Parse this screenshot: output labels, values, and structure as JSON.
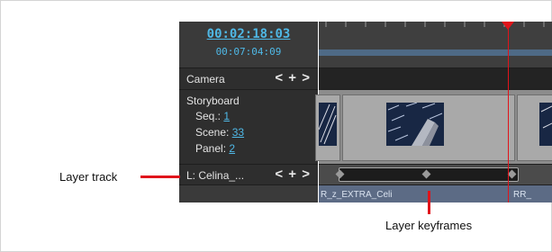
{
  "timecode": {
    "main": "00:02:18:03",
    "sub": "00:07:04:09"
  },
  "camera": {
    "label": "Camera",
    "nav": {
      "prev": "<",
      "add": "+",
      "next": ">"
    }
  },
  "storyboard": {
    "title": "Storyboard",
    "seq_label": "Seq.:",
    "seq_value": "1",
    "scene_label": "Scene:",
    "scene_value": "33",
    "panel_label": "Panel:",
    "panel_value": "2"
  },
  "layer": {
    "label": "L: Celina_...",
    "nav": {
      "prev": "<",
      "add": "+",
      "next": ">"
    }
  },
  "clips": [
    "R_z_EXTRA_Celi",
    "RR_"
  ],
  "callouts": {
    "layer_track": "Layer track",
    "layer_keyframes": "Layer keyframes"
  },
  "colors": {
    "accent": "#4fb8e6",
    "playhead": "#e0141b"
  }
}
